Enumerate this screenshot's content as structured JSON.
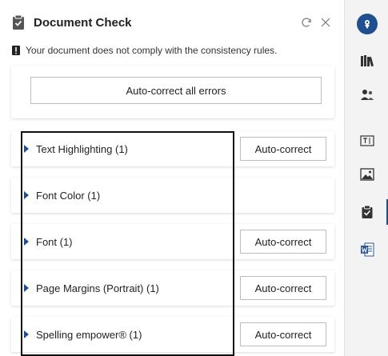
{
  "header": {
    "title": "Document Check",
    "refresh_icon": "refresh-icon",
    "close_icon": "close-icon"
  },
  "status": {
    "message": "Your document does not comply with the consistency rules."
  },
  "autocorrect_all": {
    "label": "Auto-correct all errors"
  },
  "groups": [
    {
      "label": "Text Highlighting (1)",
      "action": "Auto-correct"
    },
    {
      "label": "Font Color (1)",
      "action": null
    },
    {
      "label": "Font (1)",
      "action": "Auto-correct"
    },
    {
      "label": "Page Margins (Portrait) (1)",
      "action": "Auto-correct"
    },
    {
      "label": "Spelling empower® (1)",
      "action": "Auto-correct"
    }
  ],
  "sidebar": {
    "items": [
      {
        "name": "app-logo-icon",
        "active": false
      },
      {
        "name": "library-icon",
        "active": false
      },
      {
        "name": "people-icon",
        "active": false
      },
      {
        "name": "text-field-icon",
        "active": false
      },
      {
        "name": "image-icon",
        "active": false
      },
      {
        "name": "document-check-icon",
        "active": true
      },
      {
        "name": "word-document-icon",
        "active": false
      }
    ]
  },
  "colors": {
    "accent": "#1f4f8f",
    "sidebar_bg": "#f3f3f3",
    "word_blue": "#2b579a"
  }
}
